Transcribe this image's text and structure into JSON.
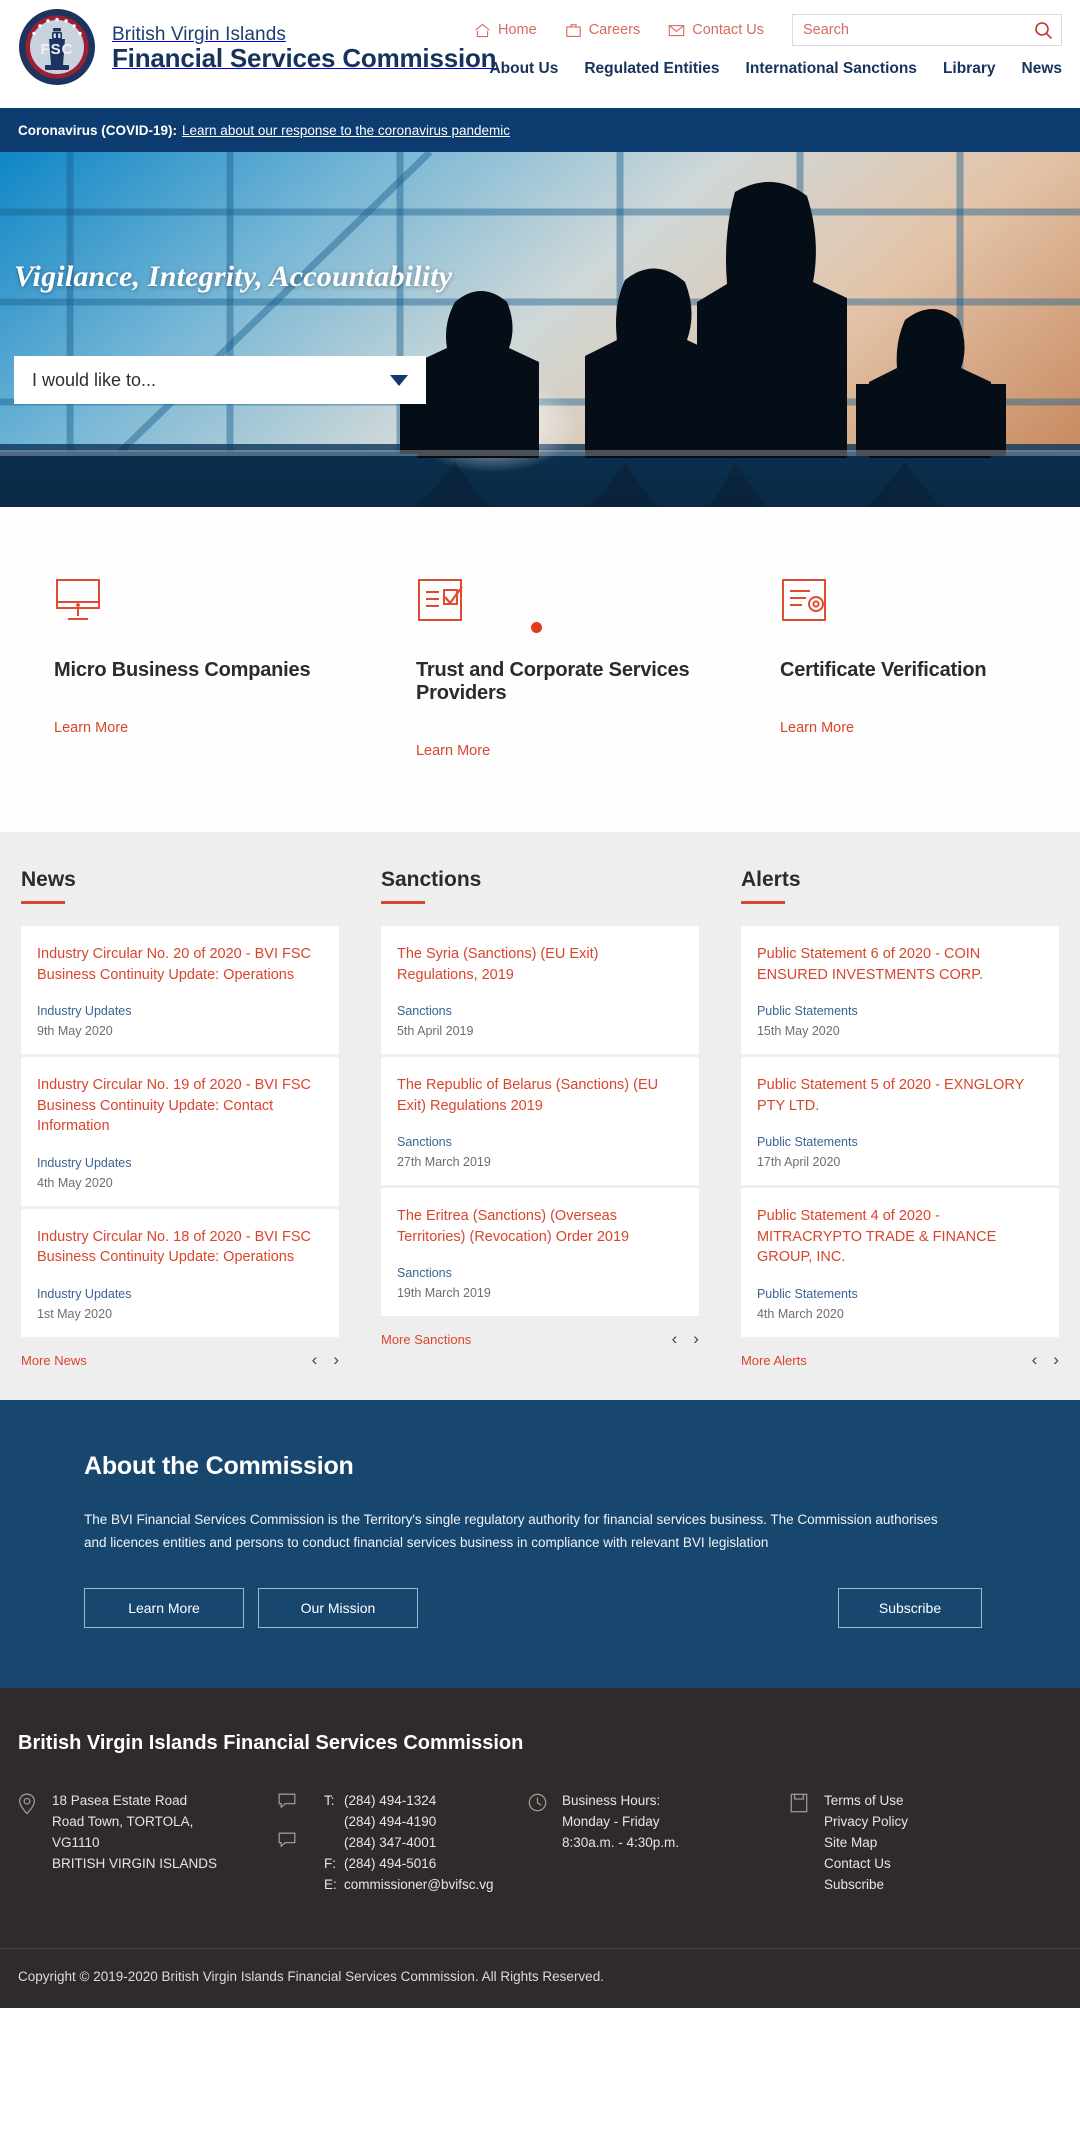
{
  "header": {
    "brand_line1": "British Virgin Islands",
    "brand_line2": "Financial Services Commission",
    "seal_text_top": "BRITISH VIRGIN ISLANDS",
    "seal_text_bottom": "FINANCIAL SERVICES COMMISSION",
    "seal_monogram": "FSC",
    "utility": [
      {
        "label": "Home",
        "icon": "home-icon"
      },
      {
        "label": "Careers",
        "icon": "briefcase-icon"
      },
      {
        "label": "Contact Us",
        "icon": "envelope-icon"
      }
    ],
    "search": {
      "placeholder": "Search",
      "value": "",
      "icon": "search-icon"
    },
    "nav": [
      {
        "label": "About Us"
      },
      {
        "label": "Regulated Entities"
      },
      {
        "label": "International Sanctions"
      },
      {
        "label": "Library"
      },
      {
        "label": "News"
      }
    ]
  },
  "covid": {
    "prefix": "Coronavirus (COVID-19):",
    "link": "Learn about our response to the coronavirus pandemic"
  },
  "hero": {
    "title": "Vigilance, Integrity, Accountability",
    "select_value": "I would like to...",
    "carousel_dot": "slide-1"
  },
  "services": [
    {
      "title": "Micro Business Companies",
      "link": "Learn More",
      "icon": "monitor-icon"
    },
    {
      "title": "Trust and Corporate Services Providers",
      "link": "Learn More",
      "icon": "checklist-icon"
    },
    {
      "title": "Certificate Verification",
      "link": "Learn More",
      "icon": "certificate-icon"
    }
  ],
  "feeds": [
    {
      "heading": "News",
      "more_label": "More News",
      "items": [
        {
          "title": "Industry Circular No. 20 of 2020 - BVI FSC Business Continuity Update: Operations",
          "category": "Industry Updates",
          "date": "9th May 2020"
        },
        {
          "title": "Industry Circular No. 19 of 2020 - BVI FSC Business Continuity Update: Contact Information",
          "category": "Industry Updates",
          "date": "4th May 2020"
        },
        {
          "title": "Industry Circular No. 18 of 2020 - BVI FSC Business Continuity Update: Operations",
          "category": "Industry Updates",
          "date": "1st May 2020"
        }
      ]
    },
    {
      "heading": "Sanctions",
      "more_label": "More Sanctions",
      "items": [
        {
          "title": "The Syria (Sanctions) (EU Exit) Regulations, 2019",
          "category": "Sanctions",
          "date": "5th April 2019"
        },
        {
          "title": "The Republic of Belarus (Sanctions) (EU Exit) Regulations 2019",
          "category": "Sanctions",
          "date": "27th March 2019"
        },
        {
          "title": "The Eritrea (Sanctions) (Overseas Territories) (Revocation) Order 2019",
          "category": "Sanctions",
          "date": "19th March 2019"
        }
      ]
    },
    {
      "heading": "Alerts",
      "more_label": "More Alerts",
      "items": [
        {
          "title": "Public Statement 6 of 2020 - COIN ENSURED INVESTMENTS CORP.",
          "category": "Public Statements",
          "date": "15th May 2020"
        },
        {
          "title": "Public Statement 5 of 2020 - EXNGLORY PTY LTD.",
          "category": "Public Statements",
          "date": "17th April 2020"
        },
        {
          "title": "Public Statement 4 of 2020 - MITRACRYPTO TRADE & FINANCE GROUP, INC.",
          "category": "Public Statements",
          "date": "4th March 2020"
        }
      ]
    }
  ],
  "about": {
    "heading": "About the Commission",
    "body": "The BVI Financial Services Commission is the Territory's single regulatory authority for financial services business.  The Commission authorises and licences entities and persons to conduct financial services business in compliance with relevant BVI legislation",
    "btn_learn": "Learn More",
    "btn_mission": "Our Mission",
    "btn_subscribe": "Subscribe"
  },
  "footer": {
    "title": "British Virgin Islands Financial Services Commission",
    "address_lines": "18 Pasea Estate Road\nRoad Town, TORTOLA,\nVG1110\nBRITISH VIRGIN ISLANDS",
    "contact": {
      "t_label": "T:",
      "f_label": "F:",
      "e_label": "E:",
      "phone1": "(284) 494-1324",
      "phone2": "(284) 494-4190",
      "phone3": "(284) 347-4001",
      "fax": "(284) 494-5016",
      "email": "commissioner@bvifsc.vg"
    },
    "hours_title": "Business Hours:",
    "hours_days": "Monday - Friday",
    "hours_time": "8:30a.m. - 4:30p.m.",
    "links": [
      {
        "label": "Terms of Use"
      },
      {
        "label": "Privacy Policy"
      },
      {
        "label": "Site Map"
      },
      {
        "label": "Contact Us"
      },
      {
        "label": "Subscribe"
      }
    ],
    "copyright": "Copyright © 2019-2020 British Virgin Islands Financial Services Commission. All Rights Reserved."
  },
  "colors": {
    "brand_navy": "#16335c",
    "banner_navy": "#0d3c70",
    "accent_red": "#d9452c",
    "utility_red": "#d9695e",
    "about_blue": "#17466f",
    "footer_dark": "#2e2b2a"
  }
}
